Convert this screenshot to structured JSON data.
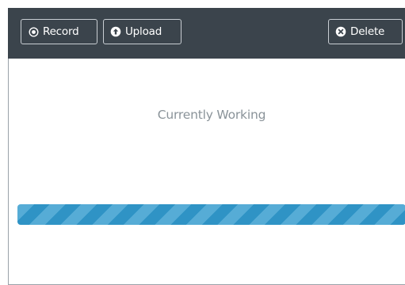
{
  "toolbar": {
    "record_label": "Record",
    "upload_label": "Upload",
    "delete_label": "Delete",
    "record_icon": "record-icon",
    "upload_icon": "upload-arrow-icon",
    "delete_icon": "delete-x-icon"
  },
  "status": {
    "text": "Currently Working"
  },
  "progress": {
    "state": "indeterminate",
    "fill_fraction": 1.0,
    "color": "#2f93c5",
    "stripe_color": "#56acd6"
  },
  "colors": {
    "toolbar_bg": "#3b444c",
    "button_border": "#c9ced3",
    "status_text": "#8a9399"
  }
}
